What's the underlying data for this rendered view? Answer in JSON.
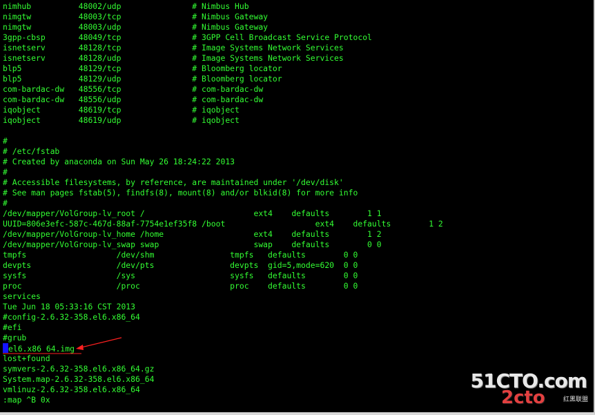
{
  "terminal": {
    "lines": [
      "nimhub          48002/udp               # Nimbus Hub",
      "nimgtw          48003/tcp               # Nimbus Gateway",
      "nimgtw          48003/udp               # Nimbus Gateway",
      "3gpp-cbsp       48049/tcp               # 3GPP Cell Broadcast Service Protocol",
      "isnetserv       48128/tcp               # Image Systems Network Services",
      "isnetserv       48128/udp               # Image Systems Network Services",
      "blp5            48129/tcp               # Bloomberg locator",
      "blp5            48129/udp               # Bloomberg locator",
      "com-bardac-dw   48556/tcp               # com-bardac-dw",
      "com-bardac-dw   48556/udp               # com-bardac-dw",
      "iqobject        48619/tcp               # iqobject",
      "iqobject        48619/udp               # iqobject",
      "",
      "#",
      "# /etc/fstab",
      "# Created by anaconda on Sun May 26 18:24:22 2013",
      "#",
      "# Accessible filesystems, by reference, are maintained under '/dev/disk'",
      "# See man pages fstab(5), findfs(8), mount(8) and/or blkid(8) for more info",
      "#",
      "/dev/mapper/VolGroup-lv_root /                       ext4    defaults        1 1",
      "UUID=806e3efc-587c-467d-88af-7754e1ef35f8 /boot                   ext4    defaults        1 2",
      "/dev/mapper/VolGroup-lv_home /home                   ext4    defaults        1 2",
      "/dev/mapper/VolGroup-lv_swap swap                    swap    defaults        0 0",
      "tmpfs                   /dev/shm                tmpfs   defaults        0 0",
      "devpts                  /dev/pts                devpts  gid=5,mode=620  0 0",
      "sysfs                   /sys                    sysfs   defaults        0 0",
      "proc                    /proc                   proc    defaults        0 0",
      "services",
      "Tue Jun 18 05:33:16 CST 2013",
      "#config-2.6.32-358.el6.x86_64",
      "#efi",
      "#grub",
      "",
      "lost+found",
      "symvers-2.6.32-358.el6.x86_64.gz",
      "System.map-2.6.32-358.el6.x86_64",
      "vmlinuz-2.6.32-358.el6.x86_64",
      ":map ^B 0x"
    ],
    "cursor_line_text": "el6.x86_64.img"
  },
  "watermark": {
    "main": "51CTO.com",
    "second": "2cto",
    "cn": "红黑联盟"
  },
  "colors": {
    "background": "#000000",
    "text": "#33ff33",
    "cursor": "#1414ff",
    "arrow": "#ff2020"
  }
}
